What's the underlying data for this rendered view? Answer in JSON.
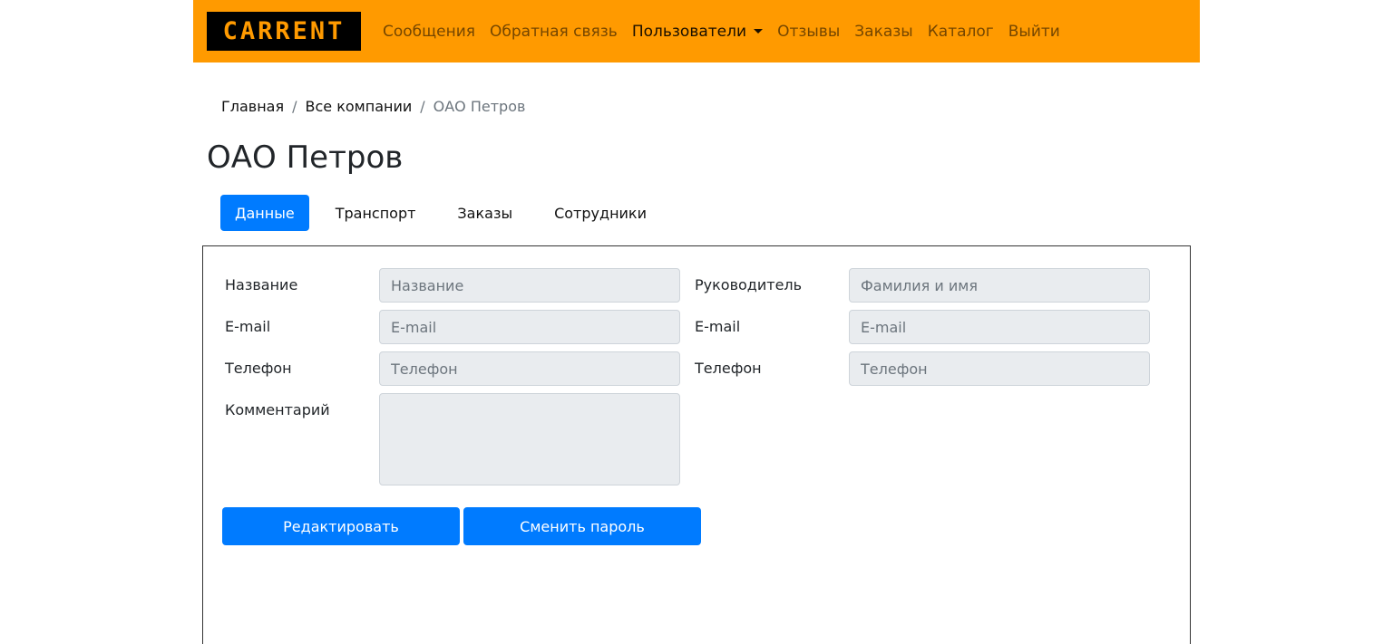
{
  "brand": {
    "logo_text": "CARRENT"
  },
  "nav": {
    "items": [
      {
        "label": "Сообщения"
      },
      {
        "label": "Обратная связь"
      },
      {
        "label": "Пользователи"
      },
      {
        "label": "Отзывы"
      },
      {
        "label": "Заказы"
      },
      {
        "label": "Каталог"
      },
      {
        "label": "Выйти"
      }
    ],
    "active_index": 2
  },
  "breadcrumb": {
    "items": [
      "Главная",
      "Все компании",
      "ОАО Петров"
    ],
    "separator": "/"
  },
  "page": {
    "title": "ОАО Петров"
  },
  "tabs": {
    "items": [
      {
        "label": "Данные"
      },
      {
        "label": "Транспорт"
      },
      {
        "label": "Заказы"
      },
      {
        "label": "Сотрудники"
      }
    ],
    "active_index": 0
  },
  "form": {
    "company": {
      "name": {
        "label": "Название",
        "placeholder": "Название",
        "value": ""
      },
      "email": {
        "label": "E-mail",
        "placeholder": "E-mail",
        "value": ""
      },
      "phone": {
        "label": "Телефон",
        "placeholder": "Телефон",
        "value": ""
      },
      "comment": {
        "label": "Комментарий",
        "value": ""
      }
    },
    "manager": {
      "name": {
        "label": "Руководитель",
        "placeholder": "Фамилия и имя",
        "value": ""
      },
      "email": {
        "label": "E-mail",
        "placeholder": "E-mail",
        "value": ""
      },
      "phone": {
        "label": "Телефон",
        "placeholder": "Телефон",
        "value": ""
      }
    },
    "buttons": {
      "edit": "Редактировать",
      "change_password": "Сменить пароль"
    }
  },
  "colors": {
    "navbar": "#ff9a00",
    "primary": "#007bff",
    "field_bg": "#e9ecef"
  }
}
